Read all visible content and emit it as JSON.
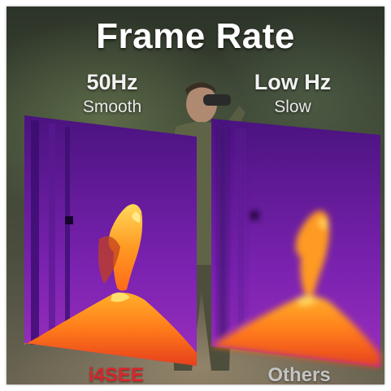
{
  "title": "Frame Rate",
  "left": {
    "heading": "50Hz",
    "subheading": "Smooth",
    "brand": "i4SEE"
  },
  "right": {
    "heading": "Low Hz",
    "subheading": "Slow",
    "brand": "Others"
  },
  "colors": {
    "brand_red": "#d9262b",
    "others_gray": "#bdbdbd",
    "thermal_dark": "#3a0f7a",
    "thermal_mid": "#9a2ad0",
    "thermal_hot": "#ff8a1a",
    "thermal_peak": "#ffe060"
  }
}
